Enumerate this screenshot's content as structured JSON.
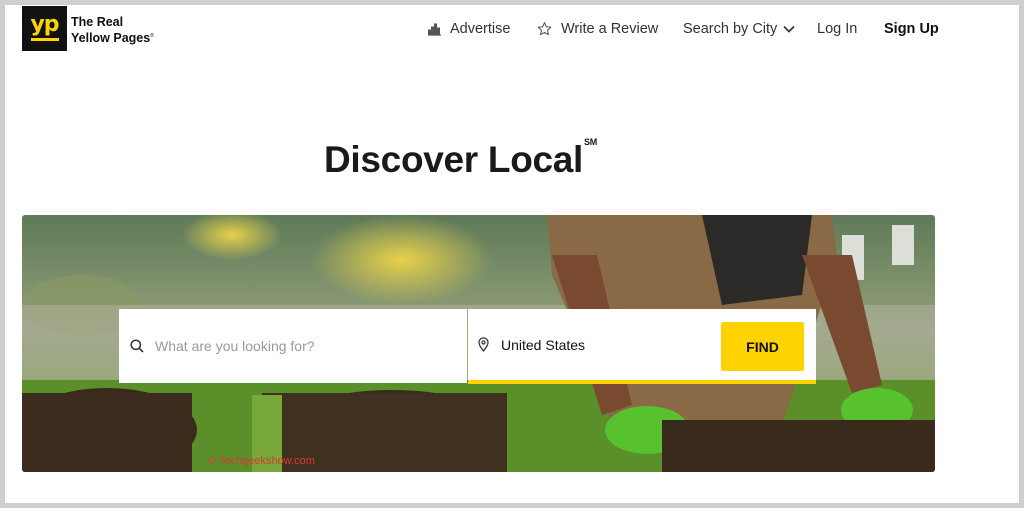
{
  "header": {
    "logo_text": "yp",
    "brand_line1": "The Real",
    "brand_line2": "Yellow Pages",
    "brand_mark": "®",
    "nav": {
      "advertise": "Advertise",
      "write_review": "Write a Review",
      "search_by_city": "Search by City",
      "log_in": "Log In",
      "sign_up": "Sign Up"
    }
  },
  "main": {
    "headline": "Discover Local",
    "headline_mark": "SM"
  },
  "search": {
    "placeholder": "What are you looking for?",
    "location_value": "United States",
    "find_label": "FIND"
  },
  "watermark": "© Techgeekshow.com",
  "colors": {
    "brand_yellow": "#ffd300",
    "logo_bg": "#111111"
  },
  "icons": {
    "advertise": "bar-chart-icon",
    "review": "star-icon",
    "city": "chevron-down-icon",
    "search": "search-icon",
    "location": "location-pin-icon"
  }
}
